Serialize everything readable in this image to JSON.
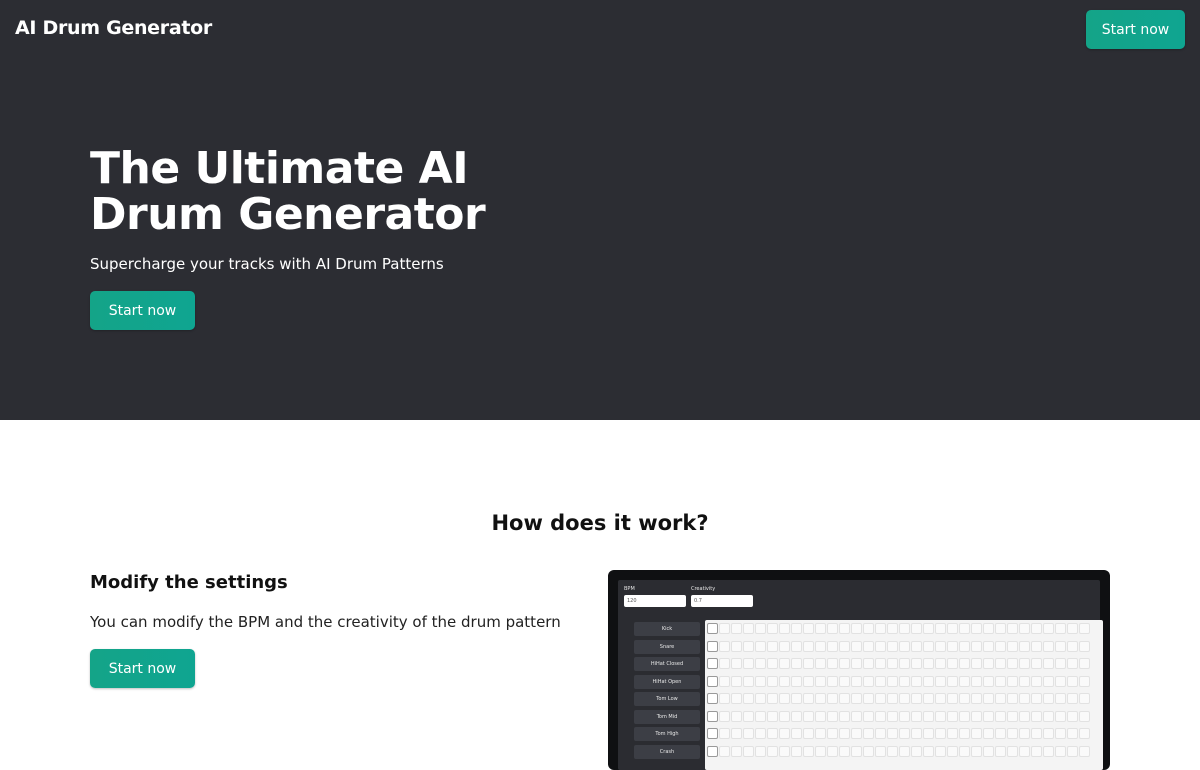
{
  "header": {
    "brand": "AI Drum Generator",
    "cta_label": "Start now"
  },
  "hero": {
    "title": "The Ultimate AI Drum Generator",
    "subtitle": "Supercharge your tracks with AI Drum Patterns",
    "cta_label": "Start now"
  },
  "how": {
    "title": "How does it work?",
    "step": {
      "title": "Modify the settings",
      "description": "You can modify the BPM and the creativity of the drum pattern",
      "cta_label": "Start now"
    }
  },
  "preview": {
    "bpm_label": "BPM",
    "bpm_value": "120",
    "creativity_label": "Creativity",
    "creativity_value": "0.7",
    "tracks": [
      "Kick",
      "Snare",
      "HiHat Closed",
      "HiHat Open",
      "Tom Low",
      "Tom Mid",
      "Tom High",
      "Crash"
    ]
  },
  "colors": {
    "hero_bg": "#2c2d33",
    "accent": "#14a488",
    "preview_frame": "#0f1012"
  }
}
